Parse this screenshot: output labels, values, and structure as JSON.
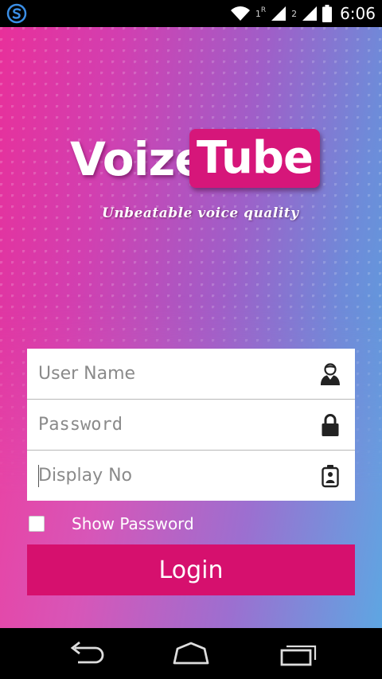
{
  "status_bar": {
    "sim1_label": "1",
    "roaming_label": "R",
    "sim2_label": "2",
    "time": "6:06"
  },
  "logo": {
    "word1": "Voize",
    "word2": "Tube",
    "tagline": "Unbeatable voice quality"
  },
  "form": {
    "username_placeholder": "User Name",
    "password_placeholder": "Password",
    "display_no_placeholder": "Display No",
    "show_password_label": "Show Password",
    "login_label": "Login"
  },
  "colors": {
    "accent": "#d6106e",
    "logo_box": "#d6167a"
  },
  "icons": {
    "username": "user-icon",
    "password": "lock-icon",
    "display_no": "id-badge-icon"
  }
}
